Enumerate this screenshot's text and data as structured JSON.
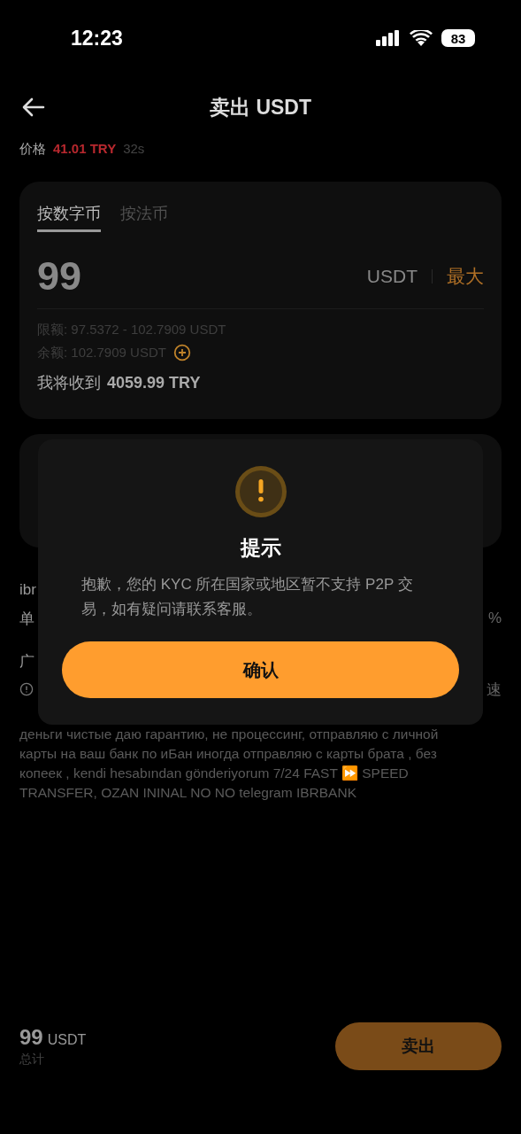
{
  "status_bar": {
    "time": "12:23",
    "battery": "83"
  },
  "header": {
    "title": "卖出 USDT"
  },
  "price": {
    "label": "价格",
    "value": "41.01 TRY",
    "countdown": "32s"
  },
  "order_card": {
    "tabs": [
      {
        "label": "按数字币",
        "selected": true
      },
      {
        "label": "按法币",
        "selected": false
      }
    ],
    "amount": "99",
    "unit": "USDT",
    "max_label": "最大",
    "limit": "限额: 97.5372 - 102.7909 USDT",
    "balance": "余额: 102.7909 USDT",
    "receive_label": "我将收到",
    "receive_value": "4059.99 TRY"
  },
  "partial_rows": [
    {
      "left": "ibr",
      "right": ""
    },
    {
      "left": "单",
      "right": "%"
    },
    {
      "left": "广",
      "right": ""
    },
    {
      "left": "",
      "right": "速",
      "info_icon": true
    }
  ],
  "description": [
    "деньги чистые даю гарантию, не процессинг, отправляю с личной",
    "карты на ваш банк по иБан иногда отправляю с карты брата , без",
    "копеек , kendi hesabından gönderiyorum 7/24 FAST ⏩  SPEED",
    "TRANSFER, OZAN ININAL NO NO                 telegram IBRBANK"
  ],
  "footer": {
    "total_amount": "99",
    "total_unit": "USDT",
    "total_label": "总计",
    "sell_button": "卖出"
  },
  "dialog": {
    "title": "提示",
    "message": "抱歉，您的 KYC 所在国家或地区暂不支持 P2P 交易，如有疑问请联系客服。",
    "confirm": "确认"
  }
}
